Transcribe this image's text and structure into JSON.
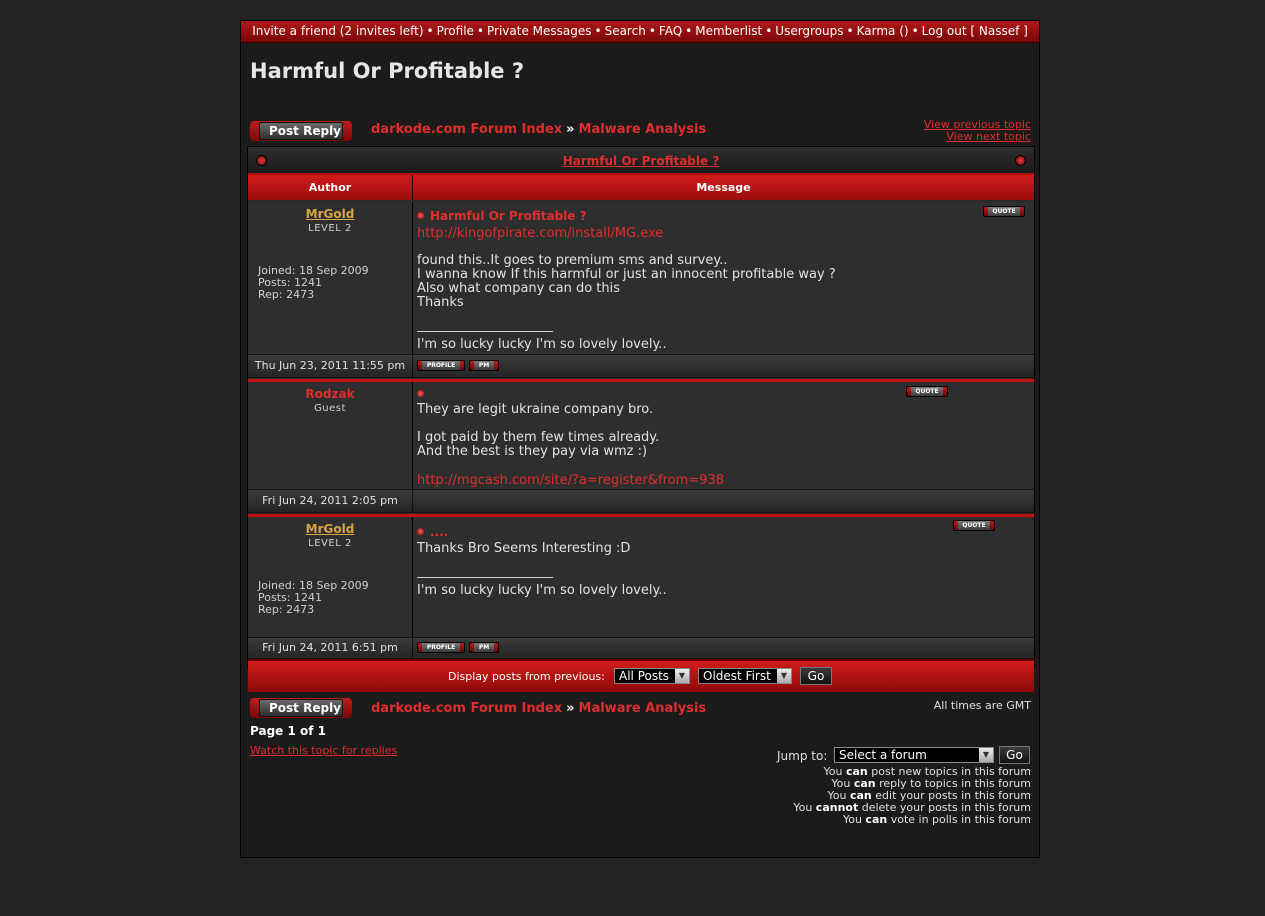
{
  "topnav": {
    "items": [
      "Invite a friend (2 invites left)",
      "Profile",
      "Private Messages",
      "Search",
      "FAQ",
      "Memberlist",
      "Usergroups",
      "Karma ()",
      "Log out [ Nassef ]"
    ],
    "separator": "•"
  },
  "topic": {
    "title": "Harmful Or Profitable ?"
  },
  "buttons": {
    "post_reply": "Post Reply",
    "go": "Go",
    "quote": "QUOTE",
    "profile": "PROFILE",
    "pm": "PM"
  },
  "breadcrumb": {
    "forum_index": "darkode.com Forum Index",
    "separator": "»",
    "forum": "Malware Analysis"
  },
  "topic_nav": {
    "previous": "View previous topic",
    "next": "View next topic"
  },
  "table": {
    "caption": "Harmful Or Profitable ?",
    "col_author": "Author",
    "col_message": "Message"
  },
  "posts": [
    {
      "author": "MrGold",
      "rank": "LEVEL 2",
      "joined": "Joined: 18 Sep 2009",
      "posts": "Posts: 1241",
      "rep": "Rep: 2473",
      "subject": "Harmful Or Profitable ?",
      "link": "http://kingofpirate.com/install/MG.exe",
      "body": "found this..It goes to premium sms and survey..\nI wanna know If this harmful or just an innocent profitable way ?\nAlso what company can do this\nThanks",
      "signature": "I'm so lucky lucky I'm so lovely lovely..",
      "date": "Thu Jun 23, 2011 11:55 pm"
    },
    {
      "author": "Rodzak",
      "rank": "Guest",
      "subject": "",
      "body": "They are legit ukraine company bro.\n\nI got paid by them few times already.\nAnd the best is they pay via wmz :)",
      "link": "http://mgcash.com/site/?a=register&from=938",
      "date": "Fri Jun 24, 2011 2:05 pm"
    },
    {
      "author": "MrGold",
      "rank": "LEVEL 2",
      "joined": "Joined: 18 Sep 2009",
      "posts": "Posts: 1241",
      "rep": "Rep: 2473",
      "subject": "....",
      "body": "Thanks Bro Seems Interesting :D",
      "signature": "I'm so lucky lucky I'm so lovely lovely..",
      "date": "Fri Jun 24, 2011 6:51 pm"
    }
  ],
  "display_filter": {
    "label": "Display posts from previous:",
    "period_value": "All Posts",
    "order_value": "Oldest First"
  },
  "footer": {
    "timezone": "All times are GMT",
    "pagination": "Page 1 of 1",
    "watch": "Watch this topic for replies",
    "jump_label": "Jump to:",
    "jump_value": "Select a forum",
    "perms": [
      {
        "pre": "You ",
        "verb": "can",
        "post": " post new topics in this forum"
      },
      {
        "pre": "You ",
        "verb": "can",
        "post": " reply to topics in this forum"
      },
      {
        "pre": "You ",
        "verb": "can",
        "post": " edit your posts in this forum"
      },
      {
        "pre": "You ",
        "verb": "cannot",
        "post": " delete your posts in this forum"
      },
      {
        "pre": "You ",
        "verb": "can",
        "post": " vote in polls in this forum"
      }
    ]
  },
  "colors": {
    "accent_red": "#e02d2d",
    "author_gold": "#d9a441",
    "author_guest": "#e02d2d"
  }
}
